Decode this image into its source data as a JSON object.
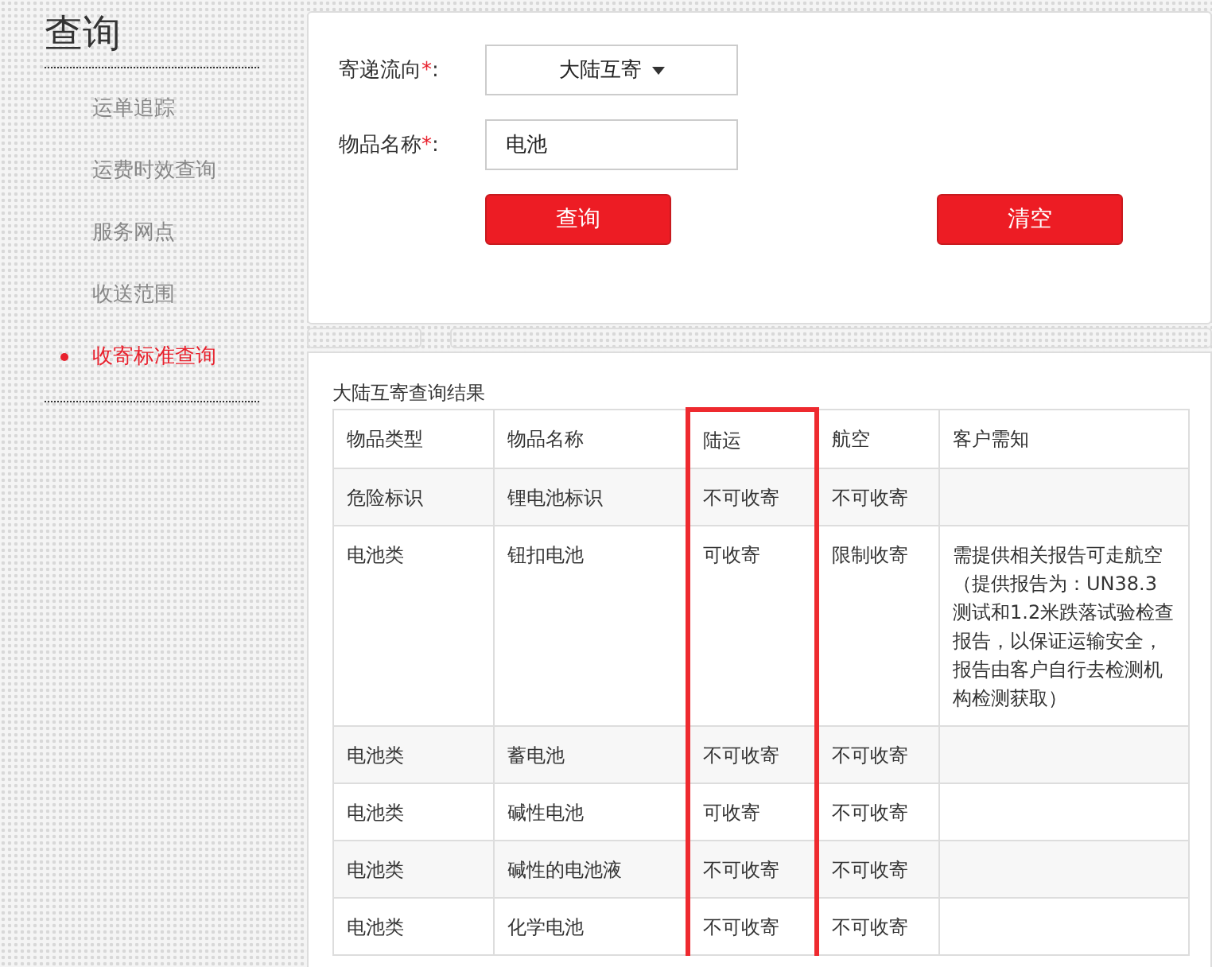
{
  "sidebar": {
    "title": "查询",
    "items": [
      {
        "label": "运单追踪",
        "selected": false
      },
      {
        "label": "运费时效查询",
        "selected": false
      },
      {
        "label": "服务网点",
        "selected": false
      },
      {
        "label": "收送范围",
        "selected": false
      },
      {
        "label": "收寄标准查询",
        "selected": true
      }
    ]
  },
  "form": {
    "fields": [
      {
        "kind": "select",
        "label": "寄递流向",
        "required": "*",
        "suffix": ":",
        "value": "大陆互寄"
      },
      {
        "kind": "input",
        "label": "物品名称",
        "required": "*",
        "suffix": ":",
        "value": "电池"
      }
    ],
    "buttons": [
      "查询",
      "清空"
    ]
  },
  "results": {
    "title": "大陆互寄查询结果",
    "columns": [
      {
        "label": "物品类型",
        "highlighted": false
      },
      {
        "label": "物品名称",
        "highlighted": false
      },
      {
        "label": "陆运",
        "highlighted": true
      },
      {
        "label": "航空",
        "highlighted": false
      },
      {
        "label": "客户需知",
        "highlighted": false
      }
    ],
    "rows": [
      [
        "危险标识",
        "锂电池标识",
        "不可收寄",
        "不可收寄",
        ""
      ],
      [
        "电池类",
        "钮扣电池",
        "可收寄",
        "限制收寄",
        "需提供相关报告可走航空（提供报告为：UN38.3测试和1.2米跌落试验检查报告，以保证运输安全，报告由客户自行去检测机构检测获取）"
      ],
      [
        "电池类",
        "蓄电池",
        "不可收寄",
        "不可收寄",
        ""
      ],
      [
        "电池类",
        "碱性电池",
        "可收寄",
        "不可收寄",
        ""
      ],
      [
        "电池类",
        "碱性的电池液",
        "不可收寄",
        "不可收寄",
        ""
      ],
      [
        "电池类",
        "化学电池",
        "不可收寄",
        "不可收寄",
        ""
      ]
    ]
  }
}
